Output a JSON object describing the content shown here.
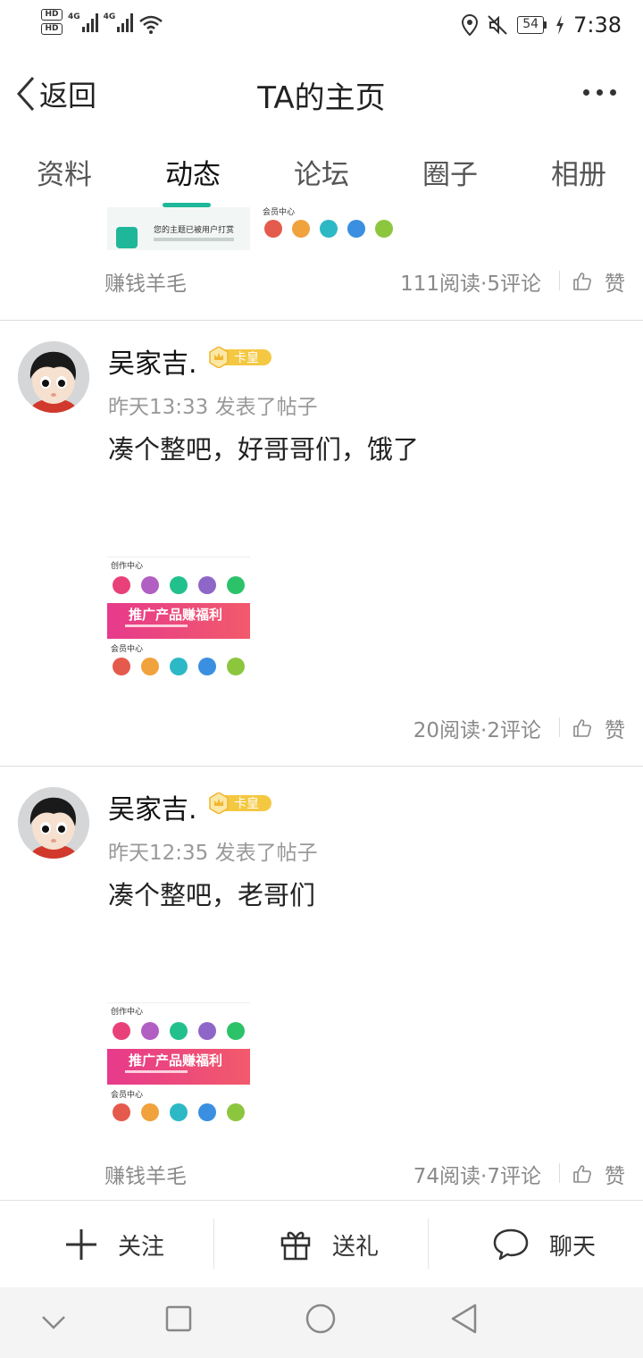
{
  "status_bar": {
    "hd1": "HD",
    "hd2": "HD",
    "net1": "4G",
    "net2": "4G",
    "battery": "54",
    "time": "7:38"
  },
  "header": {
    "back_label": "返回",
    "title": "TA的主页"
  },
  "tabs": [
    "资料",
    "动态",
    "论坛",
    "圈子",
    "相册"
  ],
  "active_tab": 1,
  "posts": [
    {
      "tag": "赚钱羊毛",
      "stats": "111阅读·5评论",
      "like": "赞"
    },
    {
      "username": "吴家吉.",
      "badge": "卡皇",
      "meta": "昨天13:33 发表了帖子",
      "content": "凑个整吧，好哥哥们，饿了",
      "stats": "20阅读·2评论",
      "like": "赞"
    },
    {
      "username": "吴家吉.",
      "badge": "卡皇",
      "meta": "昨天12:35 发表了帖子",
      "content": "凑个整吧，老哥们",
      "tag": "赚钱羊毛",
      "stats": "74阅读·7评论",
      "like": "赞"
    }
  ],
  "thumbnail": {
    "section1": "创作中心",
    "banner": "推广产品赚福利",
    "section2": "会员中心",
    "partial_notice": "您的主题已被用户打赏",
    "partial_section": "会员中心"
  },
  "actions": {
    "follow": "关注",
    "gift": "送礼",
    "chat": "聊天"
  },
  "colors": {
    "accent": "#1fb79a",
    "badge": "#f5c842"
  }
}
